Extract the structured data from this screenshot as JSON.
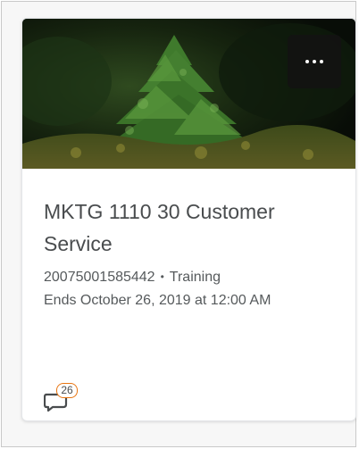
{
  "card": {
    "title": "MKTG 1110 30 Customer Service",
    "code": "20075001585442",
    "separator": "•",
    "semester": "Training",
    "end_date": "Ends October 26, 2019 at 12:00 AM",
    "image": {
      "subject": "pine seedling on mossy forest floor"
    },
    "menu": {
      "icon": "more-horizontal-icon"
    },
    "notifications": {
      "count": "26",
      "icon": "chat-bubble-icon",
      "badge_color": "#e87511"
    }
  },
  "colors": {
    "title": "#494c4e",
    "meta": "#565a5c",
    "card_border": "#e3e5e8"
  }
}
